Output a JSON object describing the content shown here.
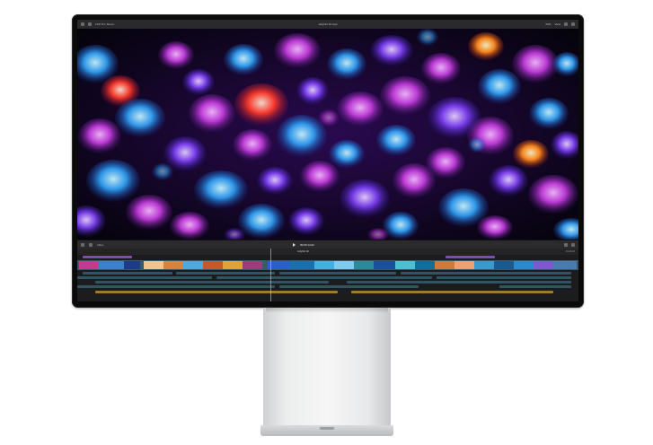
{
  "window": {
    "library": "FCP Pro 'Demo'",
    "project": "Jellyfish 4K.fcpx",
    "zoom": "59%",
    "view": "View"
  },
  "transport": {
    "timecode": "00:00:14:22",
    "index": "Index"
  },
  "timeline": {
    "project_name": "Jellyfish 4K",
    "duration": "01:24:18"
  },
  "colors": {
    "bezel": "#0a0a0a",
    "ui_background": "#1b1b1d",
    "primary_storyline": "#3b5a69",
    "connected_clip": "#2f5563",
    "audio_clip": "#a07a2e",
    "title_clip": "#7a4fb0"
  },
  "icons": [
    "library-icon",
    "browser-icon",
    "inspector-icon",
    "share-icon",
    "play-icon",
    "blade-tool-icon",
    "select-tool-icon",
    "zoom-icon",
    "audio-meter-icon"
  ]
}
